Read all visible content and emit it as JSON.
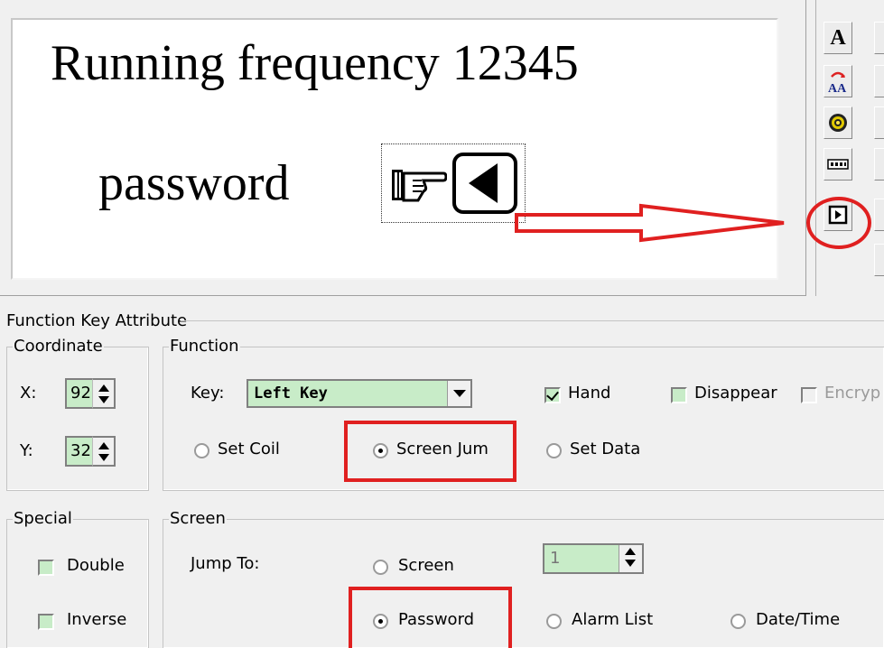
{
  "preview": {
    "line1": "Running frequency 12345",
    "line2": "password"
  },
  "toolbar": {
    "buttons": [
      "text-tool-icon",
      "dynamic-text-tool-icon",
      "lamp-tool-icon",
      "numeric-display-tool-icon",
      "function-key-tool-icon"
    ],
    "text_glyph": "A",
    "text2_glyph": "AA"
  },
  "attribute_panel": {
    "title": "Function Key Attribute",
    "coordinate": {
      "legend": "Coordinate",
      "x_label": "X:",
      "x_value": "92",
      "y_label": "Y:",
      "y_value": "32"
    },
    "function": {
      "legend": "Function",
      "key_label": "Key:",
      "key_value": "Left Key",
      "hand_label": "Hand",
      "hand_checked": true,
      "disappear_label": "Disappear",
      "encrypt_label": "Encryp",
      "set_coil_label": "Set Coil",
      "screen_jump_label": "Screen Jum",
      "set_data_label": "Set Data",
      "selected": "screen_jump"
    },
    "special": {
      "legend": "Special",
      "double_label": "Double",
      "inverse_label": "Inverse"
    },
    "screen": {
      "legend": "Screen",
      "jump_to_label": "Jump To:",
      "screen_label": "Screen",
      "screen_number": "1",
      "password_label": "Password",
      "alarm_list_label": "Alarm List",
      "date_time_label": "Date/Time",
      "selected": "password"
    }
  },
  "colors": {
    "highlight": "#e02020",
    "field_bg": "#c8ecc8",
    "window_bg": "#f0f0f0"
  }
}
